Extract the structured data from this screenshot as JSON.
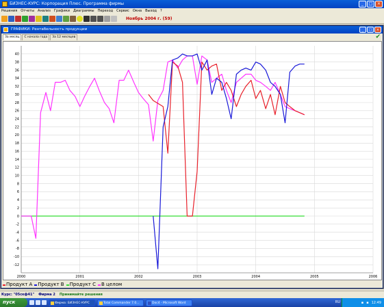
{
  "window": {
    "title": "БИЗНЕС-КУРС: Корпорация Плюс. Программа фирмы"
  },
  "menu": [
    "Решения",
    "Отчеты",
    "Анализ",
    "Графики",
    "Диаграммы",
    "Переход",
    "Сервис",
    "Окна",
    "Выход",
    "?"
  ],
  "toolbar": {
    "period": "Ноябрь 2004 г. (59)"
  },
  "child_window": {
    "title": "ГРАФИКИ: Рентабельность продукции",
    "tabs": [
      "За месяц",
      "С начала года",
      "За 12 месяцев"
    ]
  },
  "colors": {
    "product_a": "#e8202a",
    "product_b": "#1818d8",
    "product_c": "#33dd33",
    "overall": "#ff33ff"
  },
  "chart_data": {
    "type": "line",
    "title": "",
    "xlabel": "",
    "ylabel": "",
    "xlim": [
      2000,
      2006
    ],
    "ylim": [
      -14,
      42
    ],
    "y_ticks": [
      -12,
      -10,
      -8,
      -6,
      -4,
      -2,
      0,
      2,
      4,
      6,
      8,
      10,
      12,
      14,
      16,
      18,
      20,
      22,
      24,
      26,
      28,
      30,
      32,
      34,
      36,
      38,
      40
    ],
    "x_ticks": [
      "2000",
      "2001",
      "2002",
      "2003",
      "2004",
      "2005",
      "2006"
    ],
    "grid": true,
    "legend": "bottom-left",
    "series": [
      {
        "name": "Продукт А",
        "color": "#e8202a",
        "x": [
          2002.17,
          2002.25,
          2002.42,
          2002.5,
          2002.58,
          2002.67,
          2002.75,
          2002.83,
          2002.92,
          2003.0,
          2003.08,
          2003.17,
          2003.25,
          2003.33,
          2003.42,
          2003.5,
          2003.58,
          2003.67,
          2003.75,
          2003.83,
          2003.92,
          2004.0,
          2004.08,
          2004.17,
          2004.25,
          2004.33,
          2004.42,
          2004.5,
          2004.58,
          2004.67,
          2004.75,
          2004.83
        ],
        "y": [
          30,
          28.5,
          27,
          15.5,
          38,
          37,
          33,
          0,
          0,
          11,
          38,
          36,
          37,
          37.5,
          31,
          33,
          31,
          27,
          30,
          32,
          33.5,
          29,
          31,
          26.5,
          30,
          25,
          32,
          28,
          27,
          26,
          25.5,
          25
        ]
      },
      {
        "name": "Продукт В",
        "color": "#1818d8",
        "x": [
          2002.25,
          2002.33,
          2002.42,
          2002.5,
          2002.58,
          2002.67,
          2002.75,
          2002.83,
          2002.92,
          2003.0,
          2003.08,
          2003.17,
          2003.25,
          2003.33,
          2003.42,
          2003.5,
          2003.58,
          2003.67,
          2003.75,
          2003.83,
          2003.92,
          2004.0,
          2004.08,
          2004.17,
          2004.25,
          2004.33,
          2004.42,
          2004.5,
          2004.58,
          2004.67,
          2004.75,
          2004.83
        ],
        "y": [
          0,
          -13,
          22,
          27,
          38.5,
          39,
          40,
          39.5,
          39.5,
          40,
          36,
          38.5,
          30,
          34,
          33,
          29,
          24,
          35,
          36,
          36.5,
          36,
          38,
          37.5,
          36,
          33,
          32,
          30,
          23,
          35.5,
          37,
          37.5,
          37.5
        ]
      },
      {
        "name": "Продукт С",
        "color": "#33dd33",
        "x": [
          2000.0,
          2004.83
        ],
        "y": [
          0,
          0
        ]
      },
      {
        "name": "В целом",
        "color": "#ff33ff",
        "x": [
          2000.0,
          2000.17,
          2000.25,
          2000.33,
          2000.42,
          2000.5,
          2000.58,
          2000.67,
          2000.75,
          2000.83,
          2000.92,
          2001.0,
          2001.08,
          2001.17,
          2001.25,
          2001.33,
          2001.42,
          2001.5,
          2001.58,
          2001.67,
          2001.75,
          2001.83,
          2001.92,
          2002.0,
          2002.08,
          2002.17,
          2002.25,
          2002.33,
          2002.42,
          2002.5,
          2002.58,
          2002.67,
          2002.75,
          2002.83,
          2002.92,
          2003.0,
          2003.08,
          2003.17,
          2003.25,
          2003.33,
          2003.42,
          2003.5,
          2003.58,
          2003.67,
          2003.75,
          2003.83,
          2003.92,
          2004.0,
          2004.08,
          2004.17,
          2004.25,
          2004.33,
          2004.42,
          2004.5,
          2004.58,
          2004.67,
          2004.75,
          2004.83
        ],
        "y": [
          0,
          0,
          -5.5,
          25.5,
          30.5,
          26,
          33,
          33,
          33.5,
          31,
          29.5,
          27,
          29.5,
          32,
          34,
          31,
          28,
          26.5,
          23,
          33.5,
          33.5,
          36,
          33,
          30.5,
          29,
          27.5,
          18.5,
          28.5,
          31,
          38,
          38.5,
          36.5,
          38.5,
          39.5,
          39.5,
          32.5,
          39.5,
          38.5,
          33,
          34,
          35,
          31,
          28,
          33,
          34,
          35,
          35,
          33.5,
          33,
          32,
          31,
          33,
          30,
          27,
          26.5,
          26,
          25.5,
          25
        ]
      }
    ]
  },
  "statusbar": {
    "course": "Курс: \"05скф41\"",
    "firm": "Фирма 2",
    "action": "Принимайте решения"
  },
  "taskbar": {
    "start_label": "пуск",
    "tasks": [
      "Фирма: БИЗНЕС-КУРС",
      "Total Commander 7.0...",
      "Doc4 - Microsoft Word"
    ],
    "lang": "RU",
    "clock": "12:49"
  }
}
